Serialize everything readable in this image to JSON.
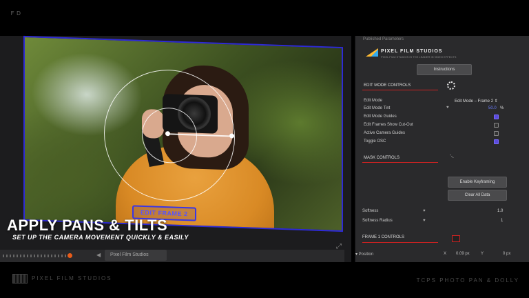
{
  "top": {
    "logo_text": "ＦＤ"
  },
  "viewer": {
    "frame_label": "EDIT FRAME 2",
    "dropdown_label": "Pixel Film Studios",
    "timeline_arrow": "◀"
  },
  "headline": {
    "title": "APPLY PANS & TILTS",
    "subtitle": "SET UP THE CAMERA MOVEMENT QUICKLY & EASILY"
  },
  "inspector": {
    "header": "Published Parameters",
    "brand_name": "PIXEL FILM STUDIOS",
    "brand_tagline": "PIXEL FILM STUDIOS IS THE LEADER IN VIDEO EFFECTS",
    "instructions_button": "Instructions",
    "edit_mode_section": "EDIT MODE CONTROLS",
    "rows": {
      "edit_mode_label": "Edit Mode",
      "edit_mode_value": "Edit Mode – Frame 2 ⇕",
      "edit_mode_tint_label": "Edit Mode Tint",
      "edit_mode_tint_value": "50.0",
      "edit_mode_tint_unit": "%",
      "edit_mode_guides_label": "Edit Mode Guides",
      "edit_frames_cutout_label": "Edit Frames Show Cut-Out",
      "active_camera_guides_label": "Active Camera Guides",
      "toggle_osc_label": "Toggle OSC"
    },
    "checkboxes": {
      "edit_mode_guides": true,
      "edit_frames_cutout": false,
      "active_camera_guides": false,
      "toggle_osc": true
    },
    "mask_section": "MASK CONTROLS",
    "enable_keyframing_button": "Enable Keyframing",
    "clear_all_data_button": "Clear All Data",
    "softness_label": "Softness",
    "softness_value": "1.0",
    "softness_radius_label": "Softness Radius",
    "softness_radius_value": "1",
    "frame1_section": "FRAME 1 CONTROLS",
    "position_label": "▾ Position",
    "position_x_label": "X",
    "position_x_value": "0.09 px",
    "position_y_label": "Y",
    "position_y_value": "0 px"
  },
  "footer": {
    "brand": "PIXEL FILM STUDIOS",
    "product": "TCPS PHOTO PAN & DOLLY"
  },
  "colors": {
    "accent_blue": "#2e2ad6",
    "section_red": "#cc2222",
    "checkbox_on": "#5b4bdc"
  }
}
